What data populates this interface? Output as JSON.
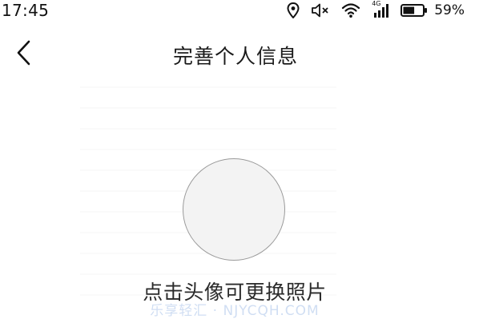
{
  "status_bar": {
    "time": "17:45",
    "network_label": "4G",
    "battery_percent": "59%",
    "battery_level": 0.59
  },
  "header": {
    "title": "完善个人信息"
  },
  "profile": {
    "hint": "点击头像可更换照片"
  },
  "watermark": {
    "text": "乐享轻汇 · NJYCQH.COM"
  },
  "icons": {
    "back": "chevron-left-icon",
    "location": "location-pin-icon",
    "mute": "speaker-muted-icon",
    "wifi": "wifi-icon",
    "signal": "cellular-signal-icon",
    "battery": "battery-icon"
  },
  "colors": {
    "background": "#ffffff",
    "avatar_fill": "#f3f3f3",
    "avatar_border": "#9a9a9a",
    "text": "#222222"
  }
}
